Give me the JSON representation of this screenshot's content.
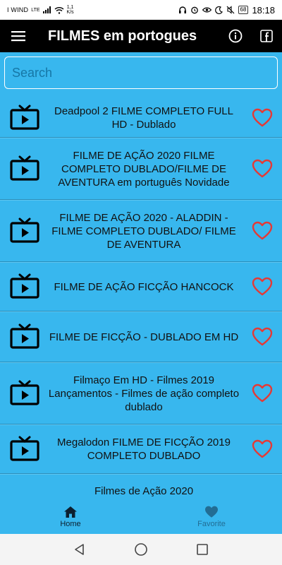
{
  "status_bar": {
    "carrier": "I WIND",
    "network_type": "LTE",
    "net_speed": "1,1",
    "net_speed_unit": "K/s",
    "battery": "68",
    "time": "18:18"
  },
  "app_bar": {
    "title": "FILMES em portogues",
    "menu_icon": "hamburger-menu-icon",
    "info_icon": "info-icon",
    "facebook_icon": "facebook-icon"
  },
  "search": {
    "placeholder": "Search",
    "value": ""
  },
  "movies": [
    {
      "title": "Deadpool 2 FILME COMPLETO FULL HD - Dublado"
    },
    {
      "title": "FILME DE AÇÃO 2020 FILME COMPLETO DUBLADO/FILME DE AVENTURA em português Novidade"
    },
    {
      "title": "FILME DE AÇÃO 2020 - ALADDIN - FILME COMPLETO DUBLADO/ FILME DE AVENTURA"
    },
    {
      "title": "FILME DE AÇÃO FICÇÃO HANCOCK"
    },
    {
      "title": "FILME DE FICÇÃO - DUBLADO EM HD"
    },
    {
      "title": "Filmaço Em HD - Filmes 2019 Lançamentos - Filmes de ação completo dublado"
    },
    {
      "title": "Megalodon FILME DE FICÇÃO 2019 COMPLETO DUBLADO"
    },
    {
      "title": "Filmes de Ação 2020"
    }
  ],
  "bottom_nav": {
    "home_label": "Home",
    "favorite_label": "Favorite"
  },
  "colors": {
    "background": "#38B7EE",
    "app_bar": "#000000",
    "heart": "#E53935"
  }
}
